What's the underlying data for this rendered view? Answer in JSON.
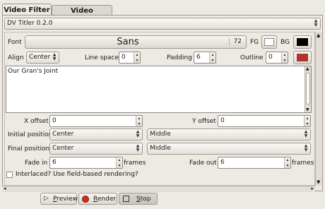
{
  "tabs": [
    {
      "label": "Video Filter",
      "active": true
    },
    {
      "label": "Video Transition",
      "active": false
    }
  ],
  "filter_select": {
    "value": "DV Titler 0.2.0"
  },
  "font": {
    "label": "Font",
    "family": "Sans",
    "size": "72",
    "fg_label": "FG",
    "bg_label": "BG",
    "fg_color": "#ffffff",
    "bg_color": "#000000"
  },
  "align": {
    "label": "Align",
    "value": "Center"
  },
  "line_space": {
    "label": "Line space",
    "value": "0"
  },
  "padding": {
    "label": "Padding",
    "value": "6"
  },
  "outline": {
    "label": "Outline",
    "value": "0",
    "color": "#b5322f"
  },
  "text": {
    "value": "Our Gran's Joint"
  },
  "x_offset": {
    "label": "X offset",
    "value": "0"
  },
  "y_offset": {
    "label": "Y offset",
    "value": "0"
  },
  "initial_position": {
    "label": "Initial position",
    "h": "Center",
    "v": "Middle"
  },
  "final_position": {
    "label": "Final position",
    "h": "Center",
    "v": "Middle"
  },
  "fade_in": {
    "label": "Fade in",
    "value": "6",
    "unit": "frames"
  },
  "fade_out": {
    "label": "Fade out",
    "value": "6",
    "unit": "frames"
  },
  "interlaced": {
    "label": "Interlaced? Use field-based rendering?",
    "checked": false
  },
  "bottom_buttons": {
    "preview": {
      "accel": "P",
      "rest": "review"
    },
    "render": {
      "accel": "R",
      "rest": "ender"
    },
    "stop": {
      "accel": "S",
      "rest": "top"
    }
  },
  "colors": {
    "render_icon": "#d42a1f",
    "outline_swatch": "#b5322f"
  }
}
